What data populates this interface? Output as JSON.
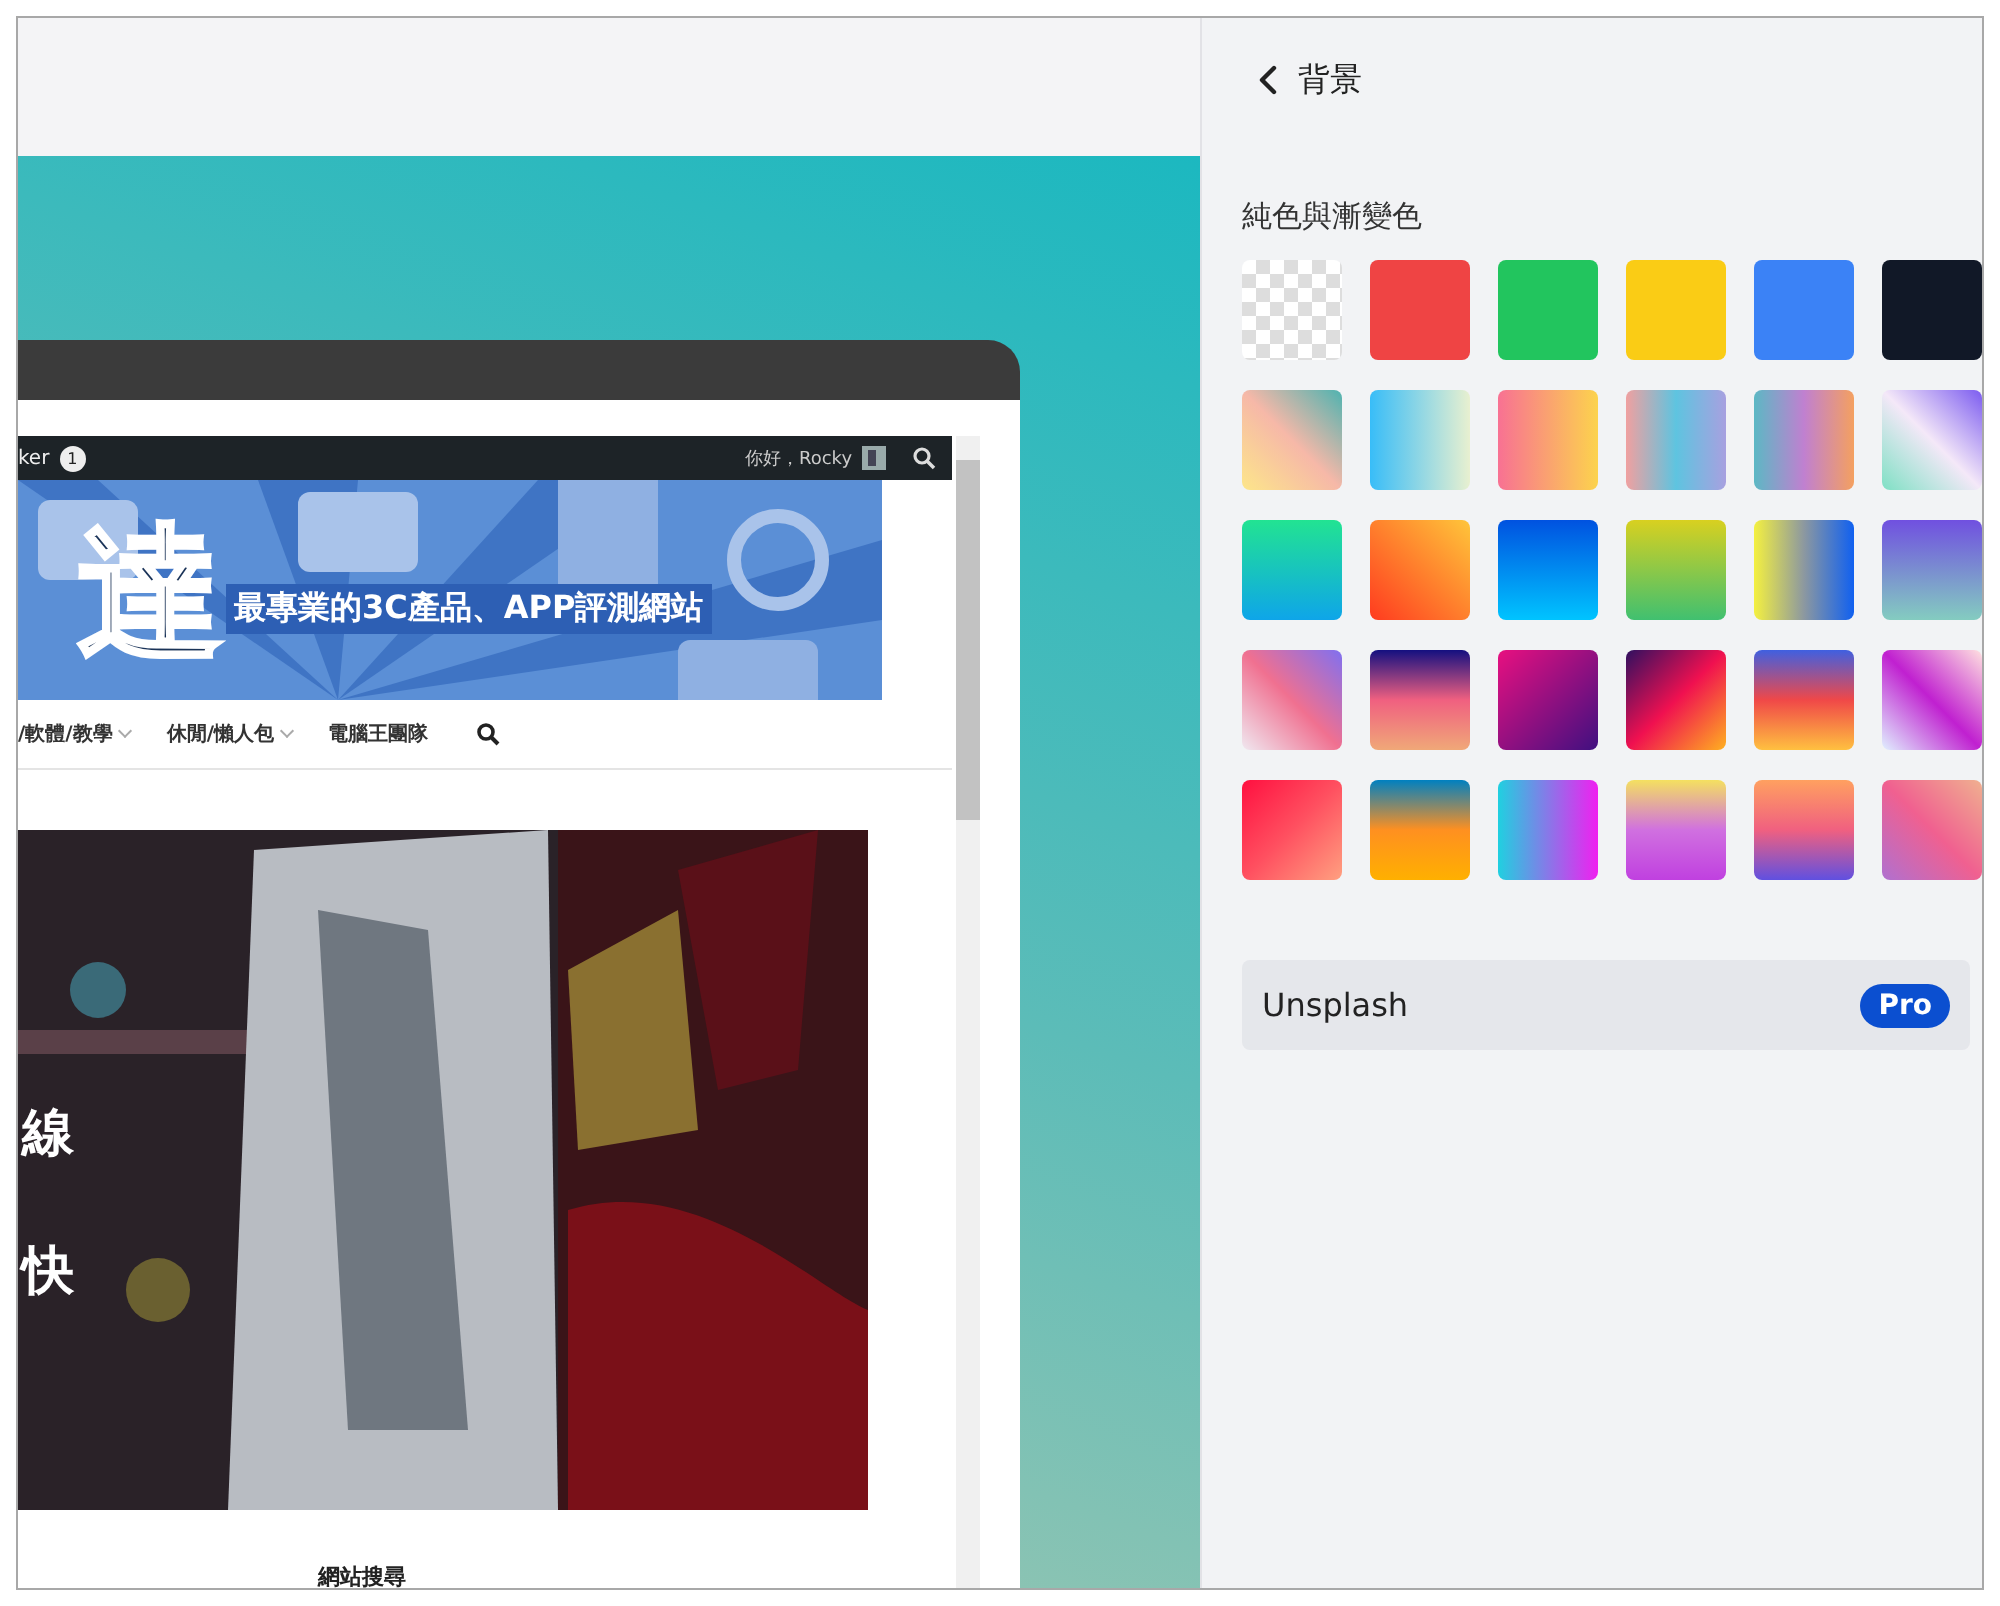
{
  "canvas": {
    "browser": {
      "admin_bar": {
        "site_label": "ker",
        "notification_count": "1",
        "greeting": "你好，Rocky"
      },
      "banner": {
        "logo_text": "達",
        "tagline": "最專業的3C產品、APP評測網站"
      },
      "nav": [
        {
          "label": "/軟體/教學",
          "has_dropdown": true
        },
        {
          "label": "休閒/懶人包",
          "has_dropdown": true
        },
        {
          "label": "電腦王團隊",
          "has_dropdown": false
        }
      ],
      "hero": {
        "kind": "picture",
        "overlay_lines": [
          "線",
          "快"
        ]
      },
      "footer_heading": "網站搜尋"
    }
  },
  "panel": {
    "title": "背景",
    "section_label": "純色與漸變色",
    "swatches": [
      {
        "kind": "transparent"
      },
      {
        "kind": "solid",
        "color": "#ef4444"
      },
      {
        "kind": "solid",
        "color": "#22c55e"
      },
      {
        "kind": "solid",
        "color": "#facc15"
      },
      {
        "kind": "solid",
        "color": "#3b82f6"
      },
      {
        "kind": "solid",
        "color": "#111827"
      },
      {
        "kind": "gradient"
      },
      {
        "kind": "gradient"
      },
      {
        "kind": "gradient"
      },
      {
        "kind": "gradient"
      },
      {
        "kind": "gradient"
      },
      {
        "kind": "gradient"
      },
      {
        "kind": "gradient"
      },
      {
        "kind": "gradient"
      },
      {
        "kind": "gradient"
      },
      {
        "kind": "gradient"
      },
      {
        "kind": "gradient"
      },
      {
        "kind": "gradient"
      },
      {
        "kind": "gradient"
      },
      {
        "kind": "gradient"
      },
      {
        "kind": "gradient"
      },
      {
        "kind": "gradient"
      },
      {
        "kind": "gradient"
      },
      {
        "kind": "gradient"
      },
      {
        "kind": "gradient"
      },
      {
        "kind": "gradient"
      },
      {
        "kind": "gradient"
      },
      {
        "kind": "gradient"
      },
      {
        "kind": "gradient"
      },
      {
        "kind": "gradient"
      }
    ],
    "unsplash": {
      "label": "Unsplash",
      "badge": "Pro"
    }
  }
}
